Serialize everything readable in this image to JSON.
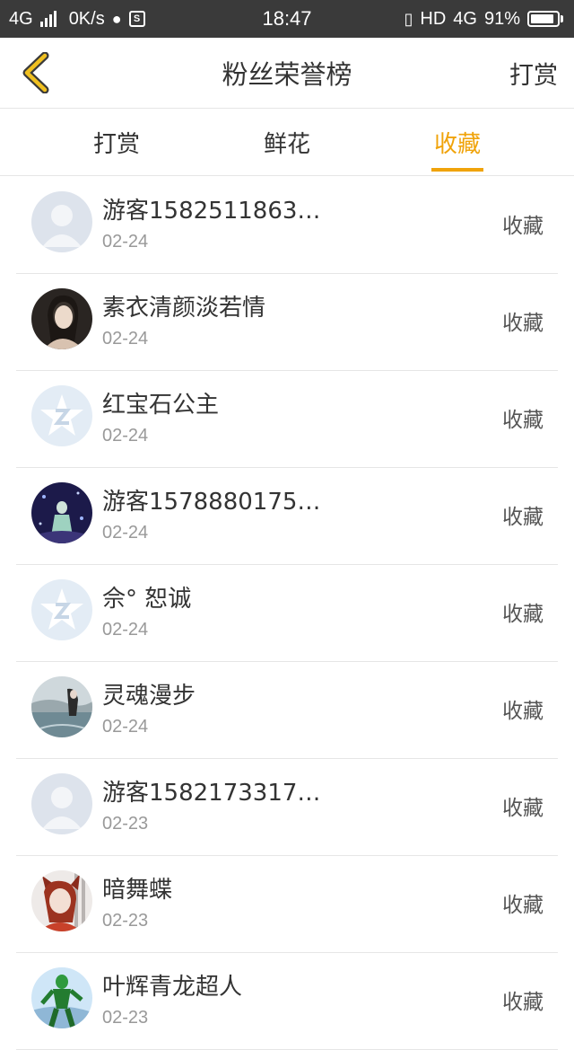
{
  "status_bar": {
    "network": "4G",
    "speed": "0K/s",
    "time": "18:47",
    "hd": "HD",
    "network_right": "4G",
    "battery_text": "91%",
    "battery_level": 0.91
  },
  "nav": {
    "title": "粉丝荣誉榜",
    "action": "打赏",
    "accent_color": "#f0a30a"
  },
  "tabs": [
    {
      "label": "打赏",
      "active": false
    },
    {
      "label": "鲜花",
      "active": false
    },
    {
      "label": "收藏",
      "active": true
    }
  ],
  "fans": [
    {
      "name": "游客1582511863…",
      "date": "02-24",
      "action": "收藏",
      "avatar": "default-user-icon"
    },
    {
      "name": "素衣清颜淡若情",
      "date": "02-24",
      "action": "收藏",
      "avatar": "photo-girl"
    },
    {
      "name": "红宝石公主",
      "date": "02-24",
      "action": "收藏",
      "avatar": "qzone-star-icon"
    },
    {
      "name": "游客1578880175…",
      "date": "02-24",
      "action": "收藏",
      "avatar": "photo-night"
    },
    {
      "name": "佘° 恕诚",
      "date": "02-24",
      "action": "收藏",
      "avatar": "qzone-star-icon"
    },
    {
      "name": "灵魂漫步",
      "date": "02-24",
      "action": "收藏",
      "avatar": "photo-lake"
    },
    {
      "name": "游客1582173317…",
      "date": "02-23",
      "action": "收藏",
      "avatar": "default-user-icon"
    },
    {
      "name": "暗舞蝶",
      "date": "02-23",
      "action": "收藏",
      "avatar": "photo-anime"
    },
    {
      "name": "叶辉青龙超人",
      "date": "02-23",
      "action": "收藏",
      "avatar": "photo-hero"
    }
  ]
}
